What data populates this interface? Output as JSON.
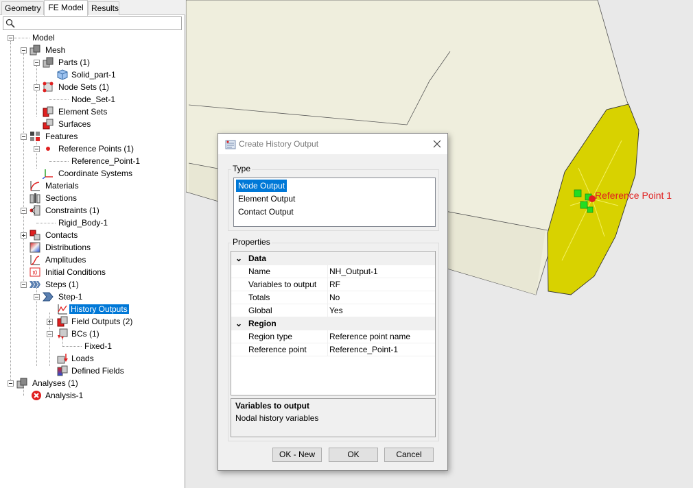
{
  "tabs": [
    "Geometry",
    "FE Model",
    "Results"
  ],
  "tree": {
    "model": "Model",
    "mesh": "Mesh",
    "parts": "Parts (1)",
    "solid_part": "Solid_part-1",
    "node_sets": "Node Sets (1)",
    "node_set": "Node_Set-1",
    "element_sets": "Element Sets",
    "surfaces": "Surfaces",
    "features": "Features",
    "reference_points": "Reference Points (1)",
    "reference_point": "Reference_Point-1",
    "coordinate_systems": "Coordinate Systems",
    "materials": "Materials",
    "sections": "Sections",
    "constraints": "Constraints (1)",
    "rigid_body": "Rigid_Body-1",
    "contacts": "Contacts",
    "distributions": "Distributions",
    "amplitudes": "Amplitudes",
    "initial_conditions": "Initial Conditions",
    "steps": "Steps (1)",
    "step": "Step-1",
    "history_outputs": "History Outputs",
    "field_outputs": "Field Outputs (2)",
    "bcs": "BCs (1)",
    "fixed": "Fixed-1",
    "loads": "Loads",
    "defined_fields": "Defined Fields",
    "analyses": "Analyses (1)",
    "analysis": "Analysis-1"
  },
  "viewport": {
    "ref_label": "Reference Point 1"
  },
  "dialog": {
    "title": "Create History Output",
    "type_group": "Type",
    "type_options": [
      "Node Output",
      "Element Output",
      "Contact Output"
    ],
    "selected_type": "Node Output",
    "properties_group": "Properties",
    "categories": {
      "data": "Data",
      "region": "Region"
    },
    "data_rows": [
      {
        "key": "Name",
        "value": "NH_Output-1"
      },
      {
        "key": "Variables to output",
        "value": "RF"
      },
      {
        "key": "Totals",
        "value": "No"
      },
      {
        "key": "Global",
        "value": "Yes"
      }
    ],
    "region_rows": [
      {
        "key": "Region type",
        "value": "Reference point name"
      },
      {
        "key": "Reference point",
        "value": "Reference_Point-1"
      }
    ],
    "help_title": "Variables to output",
    "help_text": "Nodal history variables",
    "buttons": {
      "ok_new": "OK - New",
      "ok": "OK",
      "cancel": "Cancel"
    }
  },
  "colors": {
    "selection": "#0078d7",
    "cylinder": "#efeedd",
    "end_face": "#d8d200",
    "ref_point": "#e02020",
    "marker": "#22dd22"
  }
}
